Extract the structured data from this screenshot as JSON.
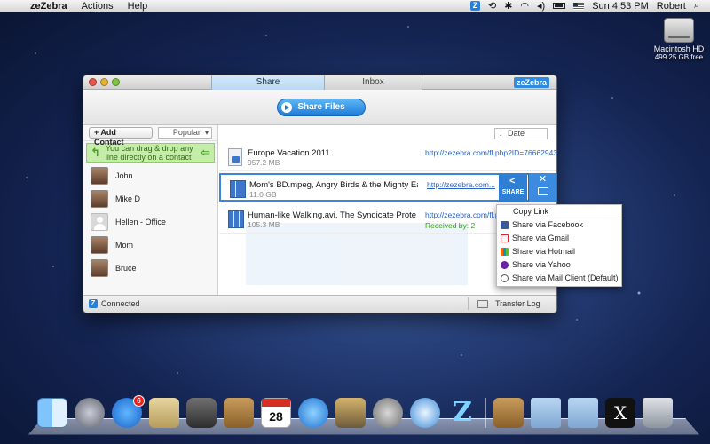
{
  "menubar": {
    "apple": "",
    "app_name": "zeZebra",
    "menus": [
      "Actions",
      "Help"
    ],
    "clock": "Sun 4:53 PM",
    "user": "Robert"
  },
  "desktop": {
    "hd_name": "Macintosh HD",
    "hd_free": "499.25 GB free"
  },
  "window": {
    "tabs": [
      "Share",
      "Inbox"
    ],
    "brand": "zeZebra",
    "share_files": "Share Files",
    "sidebar": {
      "add_contact": "+ Add Contact",
      "filter": "Popular",
      "tip": "You can drag & drop any line directly on a contact",
      "contacts": [
        "John",
        "Mike D",
        "Hellen - Office",
        "Mom",
        "Bruce"
      ]
    },
    "sort": "Date",
    "files": [
      {
        "name": "Europe Vacation 2011",
        "size": "957.2 MB",
        "link": "http://zezebra.com/fl.php?ID=76662943",
        "received": ""
      },
      {
        "name": "Mom's BD.mpeg, Angry Birds & the Mighty Eagle.avi,...",
        "size": "11.0 GB",
        "link": "http://zezebra.com...",
        "received": ""
      },
      {
        "name": "Human-like Walking.avi, The Syndicate Protection of...",
        "size": "105.3 MB",
        "link": "http://zezebra.com/fl.php?...",
        "received": "Received by: 2"
      }
    ],
    "share_label": "SHARE",
    "status": "Connected",
    "transfer_log": "Transfer Log"
  },
  "popup": {
    "copy_link": "Copy Link",
    "items": [
      "Share via Facebook",
      "Share via Gmail",
      "Share via Hotmail",
      "Share via Yahoo",
      "Share via Mail Client (Default)"
    ]
  },
  "dock": {
    "calendar_day": "28",
    "appstore_badge": "6",
    "x_label": "X"
  }
}
